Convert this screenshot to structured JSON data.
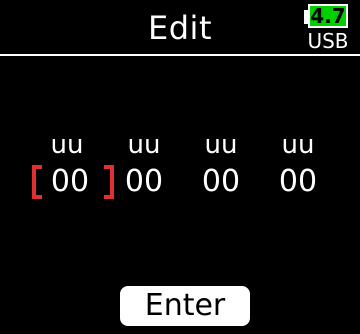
{
  "header": {
    "title": "Edit"
  },
  "battery": {
    "level": "4.7",
    "source": "USB",
    "color": "#00d000"
  },
  "fields": [
    {
      "unit": "uu",
      "value": "00",
      "selected": true
    },
    {
      "unit": "uu",
      "value": "00",
      "selected": false
    },
    {
      "unit": "uu",
      "value": "00",
      "selected": false
    },
    {
      "unit": "uu",
      "value": "00",
      "selected": false
    }
  ],
  "selection_color": "#e03030",
  "footer": {
    "enter_label": "Enter"
  }
}
